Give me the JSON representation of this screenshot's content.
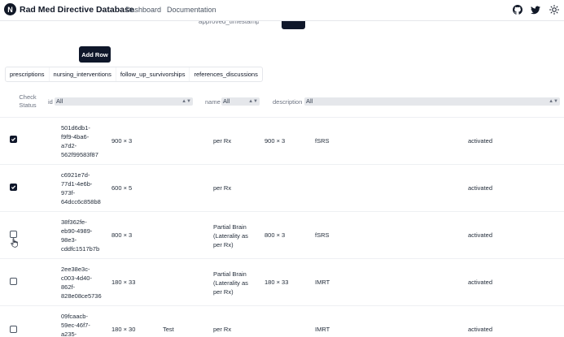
{
  "app": {
    "title": "Rad Med Directive Database",
    "logo_letter": "N"
  },
  "nav": [
    {
      "label": "Dashboard"
    },
    {
      "label": "Documentation"
    }
  ],
  "header_icons": [
    "github-icon",
    "twitter-icon",
    "sun-icon"
  ],
  "cut_label": "approved_timestamp",
  "add_row_label": "Add Row",
  "tabs": [
    {
      "label": "prescriptions"
    },
    {
      "label": "nursing_interventions"
    },
    {
      "label": "follow_up_survivorships"
    },
    {
      "label": "references_discussions"
    }
  ],
  "columns": {
    "check_status": "Check Status",
    "id": {
      "label": "id",
      "filter": "All"
    },
    "name": {
      "label": "name",
      "filter": "All"
    },
    "description": {
      "label": "description",
      "filter": "All"
    }
  },
  "rows": [
    {
      "checked": true,
      "id": [
        "501d6db1-",
        "f9f9-4ba6-",
        "a7d2-",
        "562f99583f87"
      ],
      "dose": "900 × 3",
      "name_col": "",
      "desc_lines": [
        "per Rx"
      ],
      "dose2": "900 × 3",
      "technique": "fSRS",
      "status": "activated"
    },
    {
      "checked": true,
      "id": [
        "c6921e7d-",
        "77d1-4e6b-",
        "973f-",
        "64dcc6c858b8"
      ],
      "dose": "600 × 5",
      "name_col": "",
      "desc_lines": [
        "per Rx"
      ],
      "dose2": "",
      "technique": "",
      "status": "activated"
    },
    {
      "checked": false,
      "id": [
        "38f362fe-",
        "eb90-4989-",
        "98e3-",
        "cddfc1517b7b"
      ],
      "dose": "800 × 3",
      "name_col": "",
      "desc_lines": [
        "Partial Brain",
        "(Laterality as",
        "per Rx)"
      ],
      "dose2": "800 × 3",
      "technique": "fSRS",
      "status": "activated"
    },
    {
      "checked": false,
      "id": [
        "2ee38e3c-",
        "c003-4d40-",
        "862f-",
        "828e08ce5736"
      ],
      "dose": "180 × 33",
      "name_col": "",
      "desc_lines": [
        "Partial Brain",
        "(Laterality as",
        "per Rx)"
      ],
      "dose2": "180 × 33",
      "technique": "IMRT",
      "status": "activated"
    },
    {
      "checked": false,
      "id": [
        "09fcaacb-",
        "59ec-46f7-",
        "a235-"
      ],
      "dose": "180 × 30",
      "name_col": "Test",
      "desc_lines": [
        "per Rx"
      ],
      "dose2": "",
      "technique": "IMRT",
      "status": "activated"
    }
  ]
}
